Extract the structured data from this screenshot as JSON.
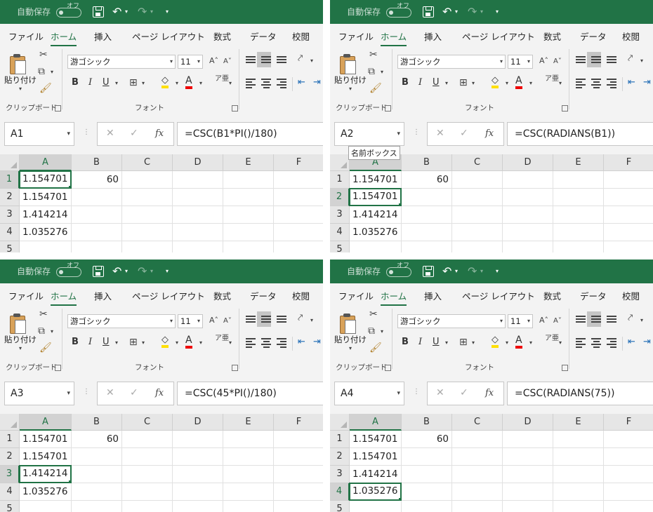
{
  "app": {
    "autosave_label": "自動保存",
    "autosave_state": "オフ",
    "tabs": [
      "ファイル",
      "ホーム",
      "挿入",
      "ページ レイアウト",
      "数式",
      "データ",
      "校閲"
    ],
    "active_tab": "ホーム",
    "ribbon": {
      "paste_label": "貼り付け",
      "clipboard_group": "クリップボード",
      "font_group": "フォント",
      "font_name": "游ゴシック",
      "font_size": "11",
      "bold": "B",
      "italic": "I",
      "underline": "U",
      "font_color_glyph": "A",
      "grow_font": "A˄",
      "shrink_font": "A˅"
    },
    "columns": [
      "A",
      "B",
      "C",
      "D",
      "E",
      "F"
    ],
    "rows": [
      "1",
      "2",
      "3",
      "4",
      "5"
    ],
    "accent_color": "#217346"
  },
  "panels": [
    {
      "name_box": "A1",
      "formula": "=CSC(B1*PI()/180)",
      "active_cell": "A1",
      "tooltip": "",
      "cells": {
        "A1": "1.154701",
        "B1": "60",
        "A2": "1.154701",
        "A3": "1.414214",
        "A4": "1.035276"
      }
    },
    {
      "name_box": "A2",
      "formula": "=CSC(RADIANS(B1))",
      "active_cell": "A2",
      "tooltip": "名前ボックス",
      "cells": {
        "A1": "1.154701",
        "B1": "60",
        "A2": "1.154701",
        "A3": "1.414214",
        "A4": "1.035276"
      }
    },
    {
      "name_box": "A3",
      "formula": "=CSC(45*PI()/180)",
      "active_cell": "A3",
      "tooltip": "",
      "cells": {
        "A1": "1.154701",
        "B1": "60",
        "A2": "1.154701",
        "A3": "1.414214",
        "A4": "1.035276"
      }
    },
    {
      "name_box": "A4",
      "formula": "=CSC(RADIANS(75))",
      "active_cell": "A4",
      "tooltip": "",
      "cells": {
        "A1": "1.154701",
        "B1": "60",
        "A2": "1.154701",
        "A3": "1.414214",
        "A4": "1.035276"
      }
    }
  ]
}
